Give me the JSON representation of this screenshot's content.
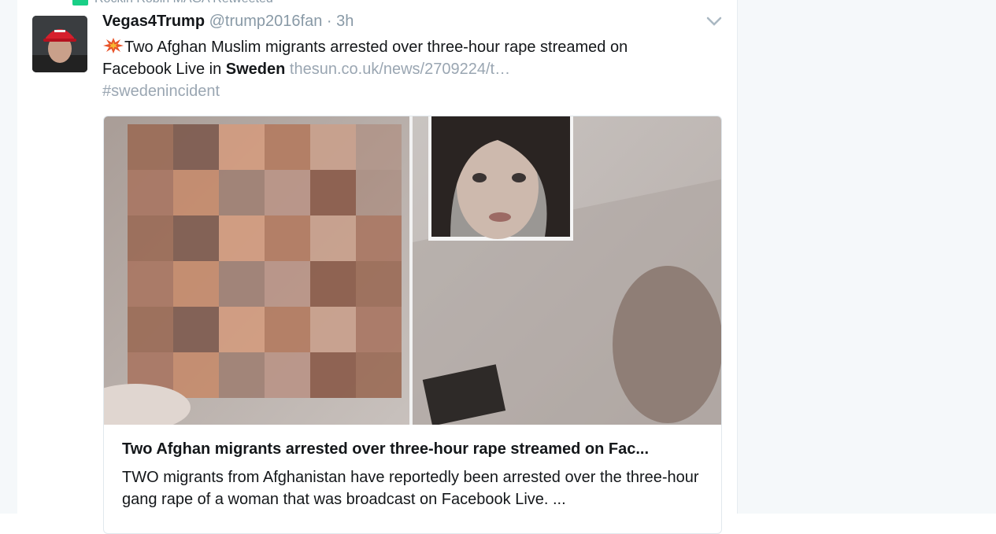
{
  "retweet_bar": {
    "label": "Rockin Robin MAGA Retweeted"
  },
  "tweet": {
    "display_name": "Vegas4Trump",
    "handle": "@trump2016fan",
    "separator": "·",
    "time": "3h",
    "text_part1": "Two Afghan Muslim migrants arrested over three-hour rape streamed on Facebook Live in ",
    "text_bold": "Sweden",
    "link": "thesun.co.uk/news/2709224/t…",
    "hashtag": "#swedenincident",
    "emoji": "collision-icon"
  },
  "card": {
    "title": "Two Afghan migrants arrested over three-hour rape streamed on Fac...",
    "description": "TWO migrants from Afghanistan have reportedly been arrested over the three-hour gang rape of a woman that was broadcast on Facebook Live. ..."
  },
  "icons": [
    "retweet-icon",
    "avatar",
    "caret-down-icon",
    "collision-icon"
  ],
  "colors": {
    "link": "#9aa6b2",
    "meta": "#8899a6",
    "retweet": "#19cf86",
    "border": "#e1e8ed"
  }
}
